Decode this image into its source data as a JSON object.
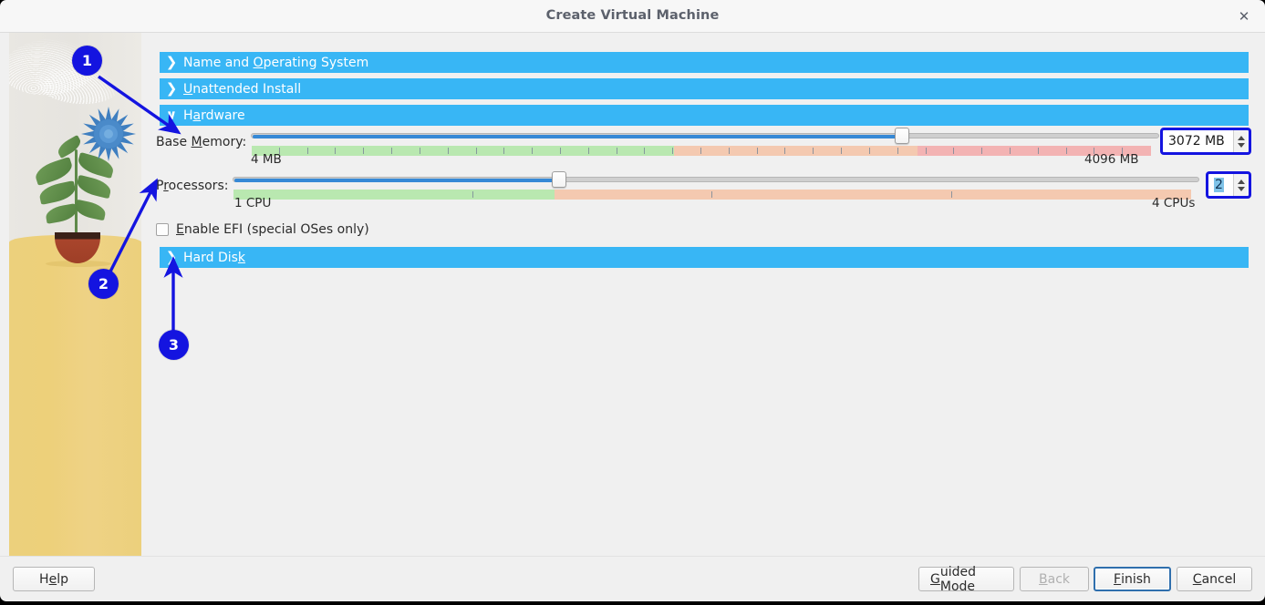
{
  "window": {
    "title": "Create Virtual Machine",
    "close_icon": "close-icon"
  },
  "sidebar": {
    "illustration_alt": "potted blue flower illustration"
  },
  "sections": [
    {
      "id": "name-and-operating-system",
      "label_pre": "Name and ",
      "label_accel": "O",
      "label_post": "perating System",
      "expanded": false,
      "chevron": "❯"
    },
    {
      "id": "unattended-install",
      "label_pre": "",
      "label_accel": "U",
      "label_post": "nattended Install",
      "expanded": false,
      "chevron": "❯"
    },
    {
      "id": "hardware",
      "label_pre": "H",
      "label_accel": "a",
      "label_post": "rdware",
      "expanded": true,
      "chevron": "∨"
    },
    {
      "id": "hard-disk",
      "label_pre": "Hard Dis",
      "label_accel": "k",
      "label_post": "",
      "expanded": false,
      "chevron": "❯"
    }
  ],
  "hardware": {
    "base_memory": {
      "label_pre": "Base ",
      "label_accel": "M",
      "label_post": "emory:",
      "min_caption": "4 MB",
      "max_caption": "4096 MB",
      "value_text": "3072 MB",
      "value": 3072,
      "min": 4,
      "max": 4096,
      "fill_percent": 72,
      "green_end_percent": 47,
      "orange_end_percent": 74,
      "focused": true
    },
    "processors": {
      "label_pre": "P",
      "label_accel": "r",
      "label_post": "ocessors:",
      "min_caption": "1 CPU",
      "max_caption": "4 CPUs",
      "value_text": "2",
      "value": 2,
      "min": 1,
      "max": 4,
      "fill_percent": 33.5,
      "green_end_percent": 33.5,
      "focused": true,
      "text_selected": true
    },
    "enable_efi": {
      "label_pre": "",
      "label_accel": "E",
      "label_post": "nable EFI (special OSes only)",
      "checked": false
    }
  },
  "footer": {
    "help": {
      "pre": "H",
      "accel": "e",
      "post": "lp"
    },
    "guided_mode": {
      "pre": "",
      "accel": "G",
      "post": "uided Mode"
    },
    "back": {
      "pre": "",
      "accel": "B",
      "post": "ack",
      "disabled": true
    },
    "finish": {
      "pre": "",
      "accel": "F",
      "post": "inish",
      "focused": true
    },
    "cancel": {
      "pre": "",
      "accel": "C",
      "post": "ancel"
    }
  },
  "annotations": [
    {
      "number": "1",
      "target": "base-memory-row"
    },
    {
      "number": "2",
      "target": "processors-row"
    },
    {
      "number": "3",
      "target": "hard-disk-section"
    }
  ],
  "colors": {
    "section_header": "#38b6f5",
    "slider_fill": "#3689d6",
    "scale_green": "#b9e8b0",
    "scale_orange": "#f4c9b0",
    "scale_pink": "#f3b3b3",
    "marker_blue": "#1414e0",
    "floor_yellow": "#ecd07c",
    "focus_blue": "#1414e0"
  }
}
